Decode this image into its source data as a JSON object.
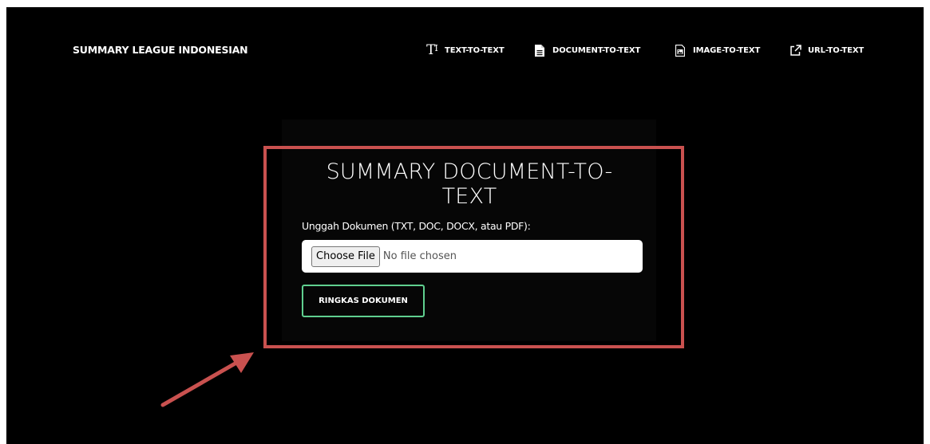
{
  "brand": "SUMMARY LEAGUE INDONESIAN",
  "nav": {
    "text_to_text": {
      "label": "TEXT-TO-TEXT",
      "icon": "text-size-icon"
    },
    "document_to_text": {
      "label": "DOCUMENT-TO-TEXT",
      "icon": "document-icon"
    },
    "image_to_text": {
      "label": "IMAGE-TO-TEXT",
      "icon": "image-icon"
    },
    "url_to_text": {
      "label": "URL-TO-TEXT",
      "icon": "external-link-icon"
    }
  },
  "card": {
    "title": "SUMMARY DOCUMENT-TO-TEXT",
    "upload_label": "Unggah Dokumen (TXT, DOC, DOCX, atau PDF):",
    "choose_file_label": "Choose File",
    "file_status": "No file chosen",
    "submit_label": "RINGKAS DOKUMEN"
  },
  "annotation": {
    "highlight_color": "#c9514f",
    "arrow_color": "#c9514f"
  },
  "colors": {
    "background": "#000000",
    "button_border": "#5fcf8f",
    "text": "#ffffff"
  }
}
